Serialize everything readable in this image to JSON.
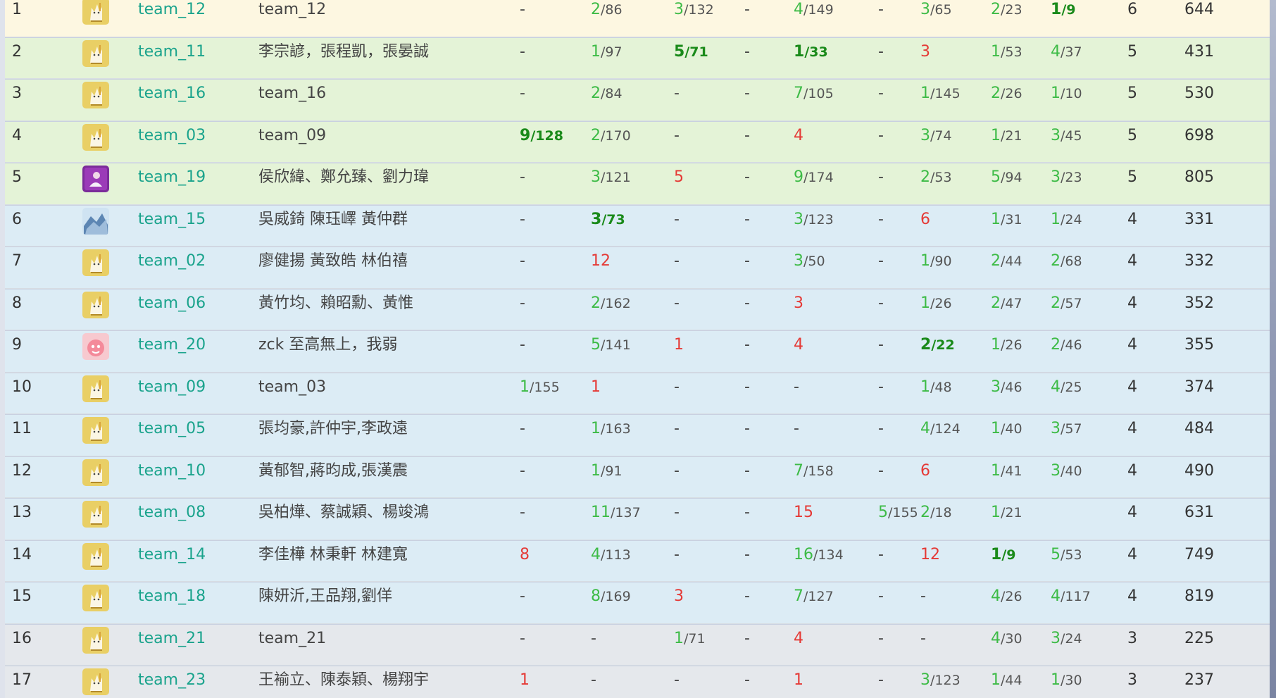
{
  "colors": {
    "team_id": "#1aa38c",
    "solved": "#3dbb46",
    "first_blood": "#1a8a1a",
    "failed": "#e53935",
    "row_gold": "#fdf7e1",
    "row_silver": "#e4f3d7",
    "row_bronze": "#dcecf5",
    "row_honor": "#e5e8ec"
  },
  "rows": [
    {
      "rank": "1",
      "team_id": "team_12",
      "name": "team_12",
      "avatar": "cat-avatar",
      "tier": "gold",
      "problems": [
        {
          "k": "none"
        },
        {
          "k": "ok",
          "n": "2",
          "t": "86"
        },
        {
          "k": "ok",
          "n": "3",
          "t": "132"
        },
        {
          "k": "none"
        },
        {
          "k": "ok",
          "n": "4",
          "t": "149"
        },
        {
          "k": "none"
        },
        {
          "k": "ok",
          "n": "3",
          "t": "65"
        },
        {
          "k": "ok",
          "n": "2",
          "t": "23"
        },
        {
          "k": "fb",
          "n": "1",
          "t": "9"
        }
      ],
      "solved": "6",
      "penalty": "644"
    },
    {
      "rank": "2",
      "team_id": "team_11",
      "name": "李宗諺，張程凱，張晏誠",
      "avatar": "cat-avatar",
      "tier": "silver",
      "problems": [
        {
          "k": "none"
        },
        {
          "k": "ok",
          "n": "1",
          "t": "97"
        },
        {
          "k": "fb",
          "n": "5",
          "t": "71"
        },
        {
          "k": "none"
        },
        {
          "k": "fb",
          "n": "1",
          "t": "33"
        },
        {
          "k": "none"
        },
        {
          "k": "bad",
          "n": "3"
        },
        {
          "k": "ok",
          "n": "1",
          "t": "53"
        },
        {
          "k": "ok",
          "n": "4",
          "t": "37"
        }
      ],
      "solved": "5",
      "penalty": "431"
    },
    {
      "rank": "3",
      "team_id": "team_16",
      "name": "team_16",
      "avatar": "cat-avatar",
      "tier": "silver",
      "problems": [
        {
          "k": "none"
        },
        {
          "k": "ok",
          "n": "2",
          "t": "84"
        },
        {
          "k": "none"
        },
        {
          "k": "none"
        },
        {
          "k": "ok",
          "n": "7",
          "t": "105"
        },
        {
          "k": "none"
        },
        {
          "k": "ok",
          "n": "1",
          "t": "145"
        },
        {
          "k": "ok",
          "n": "2",
          "t": "26"
        },
        {
          "k": "ok",
          "n": "1",
          "t": "10"
        }
      ],
      "solved": "5",
      "penalty": "530"
    },
    {
      "rank": "4",
      "team_id": "team_03",
      "name": "team_09",
      "avatar": "cat-avatar",
      "tier": "silver",
      "problems": [
        {
          "k": "fb",
          "n": "9",
          "t": "128"
        },
        {
          "k": "ok",
          "n": "2",
          "t": "170"
        },
        {
          "k": "none"
        },
        {
          "k": "none"
        },
        {
          "k": "bad",
          "n": "4"
        },
        {
          "k": "none"
        },
        {
          "k": "ok",
          "n": "3",
          "t": "74"
        },
        {
          "k": "ok",
          "n": "1",
          "t": "21"
        },
        {
          "k": "ok",
          "n": "3",
          "t": "45"
        }
      ],
      "solved": "5",
      "penalty": "698"
    },
    {
      "rank": "5",
      "team_id": "team_19",
      "name": "侯欣緯、鄭允臻、劉力瑋",
      "avatar": "purple-avatar",
      "tier": "silver",
      "problems": [
        {
          "k": "none"
        },
        {
          "k": "ok",
          "n": "3",
          "t": "121"
        },
        {
          "k": "bad",
          "n": "5"
        },
        {
          "k": "none"
        },
        {
          "k": "ok",
          "n": "9",
          "t": "174"
        },
        {
          "k": "none"
        },
        {
          "k": "ok",
          "n": "2",
          "t": "53"
        },
        {
          "k": "ok",
          "n": "5",
          "t": "94"
        },
        {
          "k": "ok",
          "n": "3",
          "t": "23"
        }
      ],
      "solved": "5",
      "penalty": "805"
    },
    {
      "rank": "6",
      "team_id": "team_15",
      "name": "吳威錡 陳珏嶧 黃仲群",
      "avatar": "blue-avatar",
      "tier": "bronze",
      "problems": [
        {
          "k": "none"
        },
        {
          "k": "fb",
          "n": "3",
          "t": "73"
        },
        {
          "k": "none"
        },
        {
          "k": "none"
        },
        {
          "k": "ok",
          "n": "3",
          "t": "123"
        },
        {
          "k": "none"
        },
        {
          "k": "bad",
          "n": "6"
        },
        {
          "k": "ok",
          "n": "1",
          "t": "31"
        },
        {
          "k": "ok",
          "n": "1",
          "t": "24"
        }
      ],
      "solved": "4",
      "penalty": "331"
    },
    {
      "rank": "7",
      "team_id": "team_02",
      "name": "廖健揚 黃致皓 林伯禧",
      "avatar": "cat-avatar",
      "tier": "bronze",
      "problems": [
        {
          "k": "none"
        },
        {
          "k": "bad",
          "n": "12"
        },
        {
          "k": "none"
        },
        {
          "k": "none"
        },
        {
          "k": "ok",
          "n": "3",
          "t": "50"
        },
        {
          "k": "none"
        },
        {
          "k": "ok",
          "n": "1",
          "t": "90"
        },
        {
          "k": "ok",
          "n": "2",
          "t": "44"
        },
        {
          "k": "ok",
          "n": "2",
          "t": "68"
        }
      ],
      "solved": "4",
      "penalty": "332"
    },
    {
      "rank": "8",
      "team_id": "team_06",
      "name": "黃竹均、賴昭勳、黃惟",
      "avatar": "cat-avatar",
      "tier": "bronze",
      "problems": [
        {
          "k": "none"
        },
        {
          "k": "ok",
          "n": "2",
          "t": "162"
        },
        {
          "k": "none"
        },
        {
          "k": "none"
        },
        {
          "k": "bad",
          "n": "3"
        },
        {
          "k": "none"
        },
        {
          "k": "ok",
          "n": "1",
          "t": "26"
        },
        {
          "k": "ok",
          "n": "2",
          "t": "47"
        },
        {
          "k": "ok",
          "n": "2",
          "t": "57"
        }
      ],
      "solved": "4",
      "penalty": "352"
    },
    {
      "rank": "9",
      "team_id": "team_20",
      "name": "zck 至高無上，我弱",
      "avatar": "pink-avatar",
      "tier": "bronze",
      "problems": [
        {
          "k": "none"
        },
        {
          "k": "ok",
          "n": "5",
          "t": "141"
        },
        {
          "k": "bad",
          "n": "1"
        },
        {
          "k": "none"
        },
        {
          "k": "bad",
          "n": "4"
        },
        {
          "k": "none"
        },
        {
          "k": "fb",
          "n": "2",
          "t": "22"
        },
        {
          "k": "ok",
          "n": "1",
          "t": "26"
        },
        {
          "k": "ok",
          "n": "2",
          "t": "46"
        }
      ],
      "solved": "4",
      "penalty": "355"
    },
    {
      "rank": "10",
      "team_id": "team_09",
      "name": "team_03",
      "avatar": "cat-avatar",
      "tier": "bronze",
      "problems": [
        {
          "k": "ok",
          "n": "1",
          "t": "155"
        },
        {
          "k": "bad",
          "n": "1"
        },
        {
          "k": "none"
        },
        {
          "k": "none"
        },
        {
          "k": "none"
        },
        {
          "k": "none"
        },
        {
          "k": "ok",
          "n": "1",
          "t": "48"
        },
        {
          "k": "ok",
          "n": "3",
          "t": "46"
        },
        {
          "k": "ok",
          "n": "4",
          "t": "25"
        }
      ],
      "solved": "4",
      "penalty": "374"
    },
    {
      "rank": "11",
      "team_id": "team_05",
      "name": "張均豪,許仲宇,李政遠",
      "avatar": "cat-avatar",
      "tier": "bronze",
      "problems": [
        {
          "k": "none"
        },
        {
          "k": "ok",
          "n": "1",
          "t": "163"
        },
        {
          "k": "none"
        },
        {
          "k": "none"
        },
        {
          "k": "none"
        },
        {
          "k": "none"
        },
        {
          "k": "ok",
          "n": "4",
          "t": "124"
        },
        {
          "k": "ok",
          "n": "1",
          "t": "40"
        },
        {
          "k": "ok",
          "n": "3",
          "t": "57"
        }
      ],
      "solved": "4",
      "penalty": "484"
    },
    {
      "rank": "12",
      "team_id": "team_10",
      "name": "黃郁智,蔣昀成,張漢震",
      "avatar": "cat-avatar",
      "tier": "bronze",
      "problems": [
        {
          "k": "none"
        },
        {
          "k": "ok",
          "n": "1",
          "t": "91"
        },
        {
          "k": "none"
        },
        {
          "k": "none"
        },
        {
          "k": "ok",
          "n": "7",
          "t": "158"
        },
        {
          "k": "none"
        },
        {
          "k": "bad",
          "n": "6"
        },
        {
          "k": "ok",
          "n": "1",
          "t": "41"
        },
        {
          "k": "ok",
          "n": "3",
          "t": "40"
        }
      ],
      "solved": "4",
      "penalty": "490"
    },
    {
      "rank": "13",
      "team_id": "team_08",
      "name": "吳柏燁、蔡誠穎、楊竣鴻",
      "avatar": "cat-avatar",
      "tier": "bronze",
      "problems": [
        {
          "k": "none"
        },
        {
          "k": "ok",
          "n": "11",
          "t": "137"
        },
        {
          "k": "none"
        },
        {
          "k": "none"
        },
        {
          "k": "bad",
          "n": "15"
        },
        {
          "k": "ok",
          "n": "5",
          "t": "155"
        },
        {
          "k": "ok",
          "n": "2",
          "t": "18"
        },
        {
          "k": "ok",
          "n": "1",
          "t": "21"
        }
      ],
      "solved": "4",
      "penalty": "631"
    },
    {
      "rank": "14",
      "team_id": "team_14",
      "name": "李佳樺 林秉軒 林建寬",
      "avatar": "cat-avatar",
      "tier": "bronze",
      "problems": [
        {
          "k": "bad",
          "n": "8"
        },
        {
          "k": "ok",
          "n": "4",
          "t": "113"
        },
        {
          "k": "none"
        },
        {
          "k": "none"
        },
        {
          "k": "ok",
          "n": "16",
          "t": "134"
        },
        {
          "k": "none"
        },
        {
          "k": "bad",
          "n": "12"
        },
        {
          "k": "fb",
          "n": "1",
          "t": "9"
        },
        {
          "k": "ok",
          "n": "5",
          "t": "53"
        }
      ],
      "solved": "4",
      "penalty": "749"
    },
    {
      "rank": "15",
      "team_id": "team_18",
      "name": "陳妍沂,王品翔,劉佯",
      "avatar": "cat-avatar",
      "tier": "bronze",
      "problems": [
        {
          "k": "none"
        },
        {
          "k": "ok",
          "n": "8",
          "t": "169"
        },
        {
          "k": "bad",
          "n": "3"
        },
        {
          "k": "none"
        },
        {
          "k": "ok",
          "n": "7",
          "t": "127"
        },
        {
          "k": "none"
        },
        {
          "k": "none"
        },
        {
          "k": "ok",
          "n": "4",
          "t": "26"
        },
        {
          "k": "ok",
          "n": "4",
          "t": "117"
        }
      ],
      "solved": "4",
      "penalty": "819"
    },
    {
      "rank": "16",
      "team_id": "team_21",
      "name": "team_21",
      "avatar": "cat-avatar",
      "tier": "honor",
      "problems": [
        {
          "k": "none"
        },
        {
          "k": "none"
        },
        {
          "k": "ok",
          "n": "1",
          "t": "71"
        },
        {
          "k": "none"
        },
        {
          "k": "bad",
          "n": "4"
        },
        {
          "k": "none"
        },
        {
          "k": "none"
        },
        {
          "k": "ok",
          "n": "4",
          "t": "30"
        },
        {
          "k": "ok",
          "n": "3",
          "t": "24"
        }
      ],
      "solved": "3",
      "penalty": "225"
    },
    {
      "rank": "17",
      "team_id": "team_23",
      "name": "王褕立、陳泰穎、楊翔宇",
      "avatar": "cat-avatar",
      "tier": "honor",
      "problems": [
        {
          "k": "bad",
          "n": "1"
        },
        {
          "k": "none"
        },
        {
          "k": "none"
        },
        {
          "k": "none"
        },
        {
          "k": "bad",
          "n": "1"
        },
        {
          "k": "none"
        },
        {
          "k": "ok",
          "n": "3",
          "t": "123"
        },
        {
          "k": "ok",
          "n": "1",
          "t": "44"
        },
        {
          "k": "ok",
          "n": "1",
          "t": "30"
        }
      ],
      "solved": "3",
      "penalty": "237"
    }
  ]
}
